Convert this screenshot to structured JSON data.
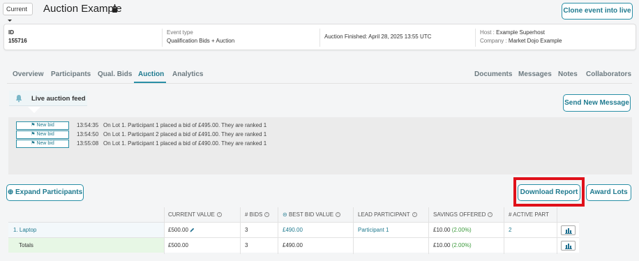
{
  "header": {
    "version_select": "Current",
    "title": "Auction Example",
    "clone_button": "Clone event into live"
  },
  "info": {
    "id_label": "ID",
    "id_value": "155716",
    "event_type_label": "Event type",
    "event_type_value": "Qualification Bids + Auction",
    "auction_status": "Auction Finished: April 28, 2025 13:55 UTC",
    "host_label": "Host :",
    "host_value": "Example Superhost",
    "company_label": "Company :",
    "company_value": "Market Dojo Example"
  },
  "tabs": {
    "left": [
      "Overview",
      "Participants",
      "Qual. Bids",
      "Auction",
      "Analytics"
    ],
    "right": [
      "Documents",
      "Messages",
      "Notes",
      "Collaborators"
    ],
    "active": "Auction"
  },
  "feed": {
    "title": "Live auction feed",
    "send_button": "Send New Message",
    "entries": [
      {
        "badge": "New bid",
        "time": "13:54:35",
        "message": "On Lot 1. Participant 1 placed a bid of £495.00. They are ranked 1"
      },
      {
        "badge": "New bid",
        "time": "13:54:50",
        "message": "On Lot 1. Participant 2 placed a bid of £491.00. They are ranked 1"
      },
      {
        "badge": "New bid",
        "time": "13:55:08",
        "message": "On Lot 1. Participant 1 placed a bid of £490.00. They are ranked 1"
      }
    ]
  },
  "actions": {
    "expand_button": "Expand Participants",
    "download_button": "Download Report",
    "award_button": "Award Lots"
  },
  "table": {
    "headers": [
      "CURRENT VALUE",
      "# BIDS",
      "BEST BID VALUE",
      "LEAD PARTICIPANT",
      "SAVINGS OFFERED",
      "# ACTIVE PART"
    ],
    "rows": [
      {
        "lot": "1. Laptop",
        "current_value": "£500.00",
        "bids": "3",
        "best_bid": "£490.00",
        "lead": "Participant 1",
        "savings": "£10.00",
        "savings_pct": "(2.00%)",
        "active": "2"
      },
      {
        "lot": "Totals",
        "current_value": "£500.00",
        "bids": "3",
        "best_bid": "£490.00",
        "lead": "",
        "savings": "£10.00",
        "savings_pct": "(2.00%)",
        "active": ""
      }
    ]
  },
  "colors": {
    "accent": "#2a8fa6",
    "highlight": "#e0101a",
    "totals_bg": "#e7f7e5"
  }
}
